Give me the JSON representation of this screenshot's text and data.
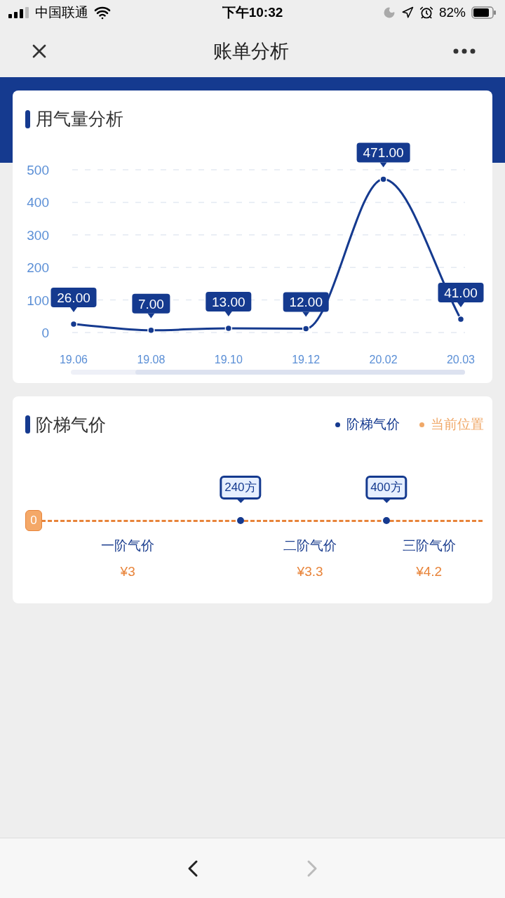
{
  "status_bar": {
    "carrier": "中国联通",
    "time": "下午10:32",
    "battery": "82%"
  },
  "nav": {
    "title": "账单分析"
  },
  "usage_card": {
    "title": "用气量分析",
    "chart_data": {
      "type": "line",
      "categories": [
        "19.06",
        "19.08",
        "19.10",
        "19.12",
        "20.02",
        "20.03"
      ],
      "series": [
        {
          "color": "#153a8f",
          "values": [
            26,
            7,
            13,
            12,
            471,
            41
          ]
        }
      ],
      "grid": true,
      "marker": true,
      "ylim": [
        0,
        500
      ],
      "yticks": [
        0,
        100,
        200,
        300,
        400,
        500
      ],
      "value_labels": [
        "26.00",
        "7.00",
        "13.00",
        "12.00",
        "471.00",
        "41.00"
      ]
    }
  },
  "price_card": {
    "title": "阶梯气价",
    "legend": [
      {
        "label": "阶梯气价",
        "color": "#153a8f"
      },
      {
        "label": "当前位置",
        "color": "#f0a868"
      }
    ],
    "current": "0",
    "thresholds": [
      "240方",
      "400方"
    ],
    "tiers": [
      {
        "name": "一阶气价",
        "price": "¥3"
      },
      {
        "name": "二阶气价",
        "price": "¥3.3"
      },
      {
        "name": "三阶气价",
        "price": "¥4.2"
      }
    ]
  },
  "toolbar": {
    "back": {
      "disabled": false
    },
    "forward": {
      "disabled": true
    }
  }
}
